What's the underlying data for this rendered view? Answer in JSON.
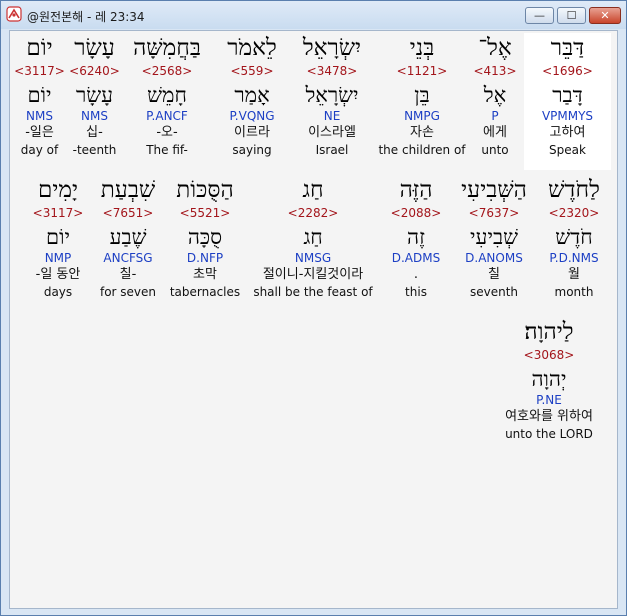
{
  "window": {
    "title": "@원전본해 - 레 23:34",
    "min_label": "—",
    "max_label": "☐",
    "close_label": "✕",
    "icon": "app-logo-icon"
  },
  "rows": [
    [
      {
        "hw": "דַּבֵּר",
        "num": "<1696>",
        "lex": "דָּבַר",
        "par": "VPMMYS",
        "kor": "고하여",
        "eng": "Speak",
        "selected": true
      },
      {
        "hw": "אֶל־",
        "num": "<413>",
        "lex": "אֶל",
        "par": "P",
        "kor": "에게",
        "eng": "unto"
      },
      {
        "hw": "בְּנֵי",
        "num": "<1121>",
        "lex": "בֵּן",
        "par": "NMPG",
        "kor": "자손",
        "eng": "the children of"
      },
      {
        "hw": "יִשְׂרָאֵל",
        "num": "<3478>",
        "lex": "יִשְׂרָאֵל",
        "par": "NE",
        "kor": "이스라엘",
        "eng": "Israel"
      },
      {
        "hw": "לֵאמֹר",
        "num": "<559>",
        "lex": "אָמַר",
        "par": "P.VQNG",
        "kor": "이르라",
        "eng": "saying"
      },
      {
        "hw": "בַּחֲמִשָּׁה",
        "num": "<2568>",
        "lex": "חָמֵשׁ",
        "par": "P.ANCF",
        "kor": "-오-",
        "eng": "The fif-"
      },
      {
        "hw": "עָשָׂר",
        "num": "<6240>",
        "lex": "עָשָׂר",
        "par": "NMS",
        "kor": "십-",
        "eng": "-teenth"
      },
      {
        "hw": "יוֹם",
        "num": "<3117>",
        "lex": "יוֹם",
        "par": "NMS",
        "kor": "-일은",
        "eng": "day of"
      }
    ],
    [
      {
        "hw": "לַחֹדֶשׁ",
        "num": "<2320>",
        "lex": "חֹדֶשׁ",
        "par": "P.D.NMS",
        "kor": "월",
        "eng": "month"
      },
      {
        "hw": "הַשְּׁבִיעִי",
        "num": "<7637>",
        "lex": "שְׁבִיעִי",
        "par": "D.ANOMS",
        "kor": "칠",
        "eng": "seventh"
      },
      {
        "hw": "הַזֶּה",
        "num": "<2088>",
        "lex": "זֶה",
        "par": "D.ADMS",
        "kor": ".",
        "eng": "this"
      },
      {
        "hw": "חַג",
        "num": "<2282>",
        "lex": "חַג",
        "par": "NMSG",
        "kor": "절이니-지킬것이라",
        "eng": "shall be the feast of"
      },
      {
        "hw": "הַסֻּכּוֹת",
        "num": "<5521>",
        "lex": "סֻכָּה",
        "par": "D.NFP",
        "kor": "초막",
        "eng": "tabernacles"
      },
      {
        "hw": "שִׁבְעַת",
        "num": "<7651>",
        "lex": "שֶׁבַע",
        "par": "ANCFSG",
        "kor": "칠-",
        "eng": "for seven"
      },
      {
        "hw": "יָמִים",
        "num": "<3117>",
        "lex": "יוֹם",
        "par": "NMP",
        "kor": "-일 동안",
        "eng": "days"
      }
    ],
    [
      {
        "hw": "לַיהוָה׃",
        "num": "<3068>",
        "lex": "יְהוָה",
        "par": "P.NE",
        "kor": "여호와를 위하여",
        "eng": "unto the LORD"
      }
    ]
  ]
}
